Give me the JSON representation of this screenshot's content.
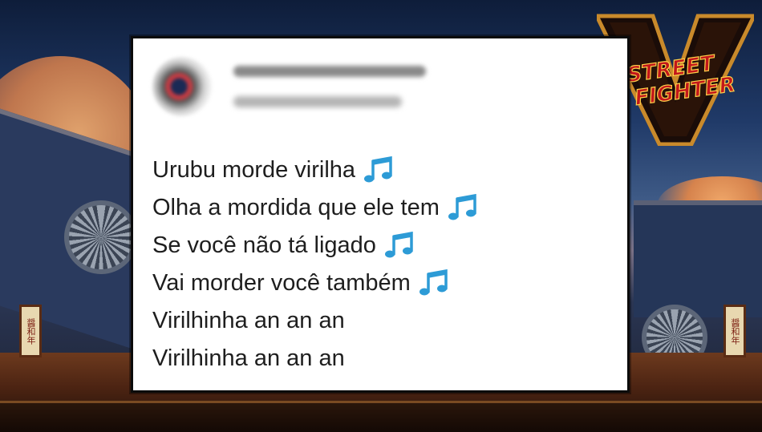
{
  "background": {
    "logo": {
      "top_text": "STREET",
      "bottom_text": "FIGHTER",
      "numeral": "V"
    },
    "sign_left_text": "醤和年",
    "sign_right_text": "醤和年"
  },
  "card": {
    "avatar_icon": "blurred-avatar",
    "lines": [
      {
        "text": "Urubu morde virilha",
        "icon": "musical-notes-icon"
      },
      {
        "text": "Olha a mordida que ele tem",
        "icon": "musical-notes-icon"
      },
      {
        "text": "Se você não tá ligado",
        "icon": "musical-notes-icon"
      },
      {
        "text": "Vai morder você também",
        "icon": "musical-notes-icon"
      },
      {
        "text": "Virilhinha an an an",
        "icon": null
      },
      {
        "text": "Virilhinha an an an",
        "icon": null
      }
    ],
    "emoji_color": "#2d9bd6"
  }
}
